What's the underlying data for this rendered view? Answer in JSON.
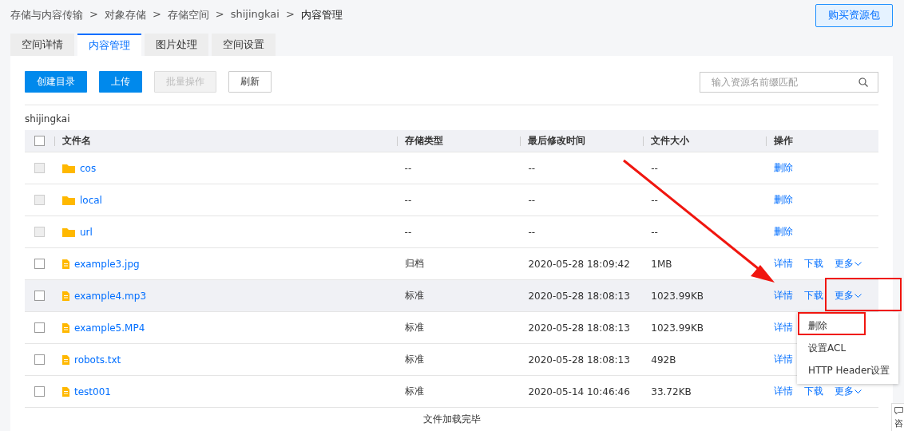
{
  "breadcrumb": [
    "存储与内容传输",
    "对象存储",
    "存储空间",
    "shijingkai",
    "内容管理"
  ],
  "breadcrumb_separator": ">",
  "buy_button": "购买资源包",
  "tabs": [
    {
      "label": "空间详情",
      "selected": false
    },
    {
      "label": "内容管理",
      "selected": true
    },
    {
      "label": "图片处理",
      "selected": false
    },
    {
      "label": "空间设置",
      "selected": false
    }
  ],
  "toolbar": [
    {
      "label": "创建目录",
      "kind": "primary",
      "disabled": false
    },
    {
      "label": "上传",
      "kind": "primary",
      "disabled": false
    },
    {
      "label": "批量操作",
      "kind": "default",
      "disabled": true
    },
    {
      "label": "刷新",
      "kind": "default",
      "disabled": false
    }
  ],
  "search": {
    "placeholder": "输入资源名前缀匹配"
  },
  "path": "shijingkai",
  "table": {
    "select_all_checked": false,
    "columns": [
      "文件名",
      "存储类型",
      "最后修改时间",
      "文件大小",
      "操作"
    ],
    "rows": [
      {
        "kind": "folder",
        "name": "cos",
        "storage": "--",
        "modified": "--",
        "size": "--",
        "actions": [
          "删除"
        ],
        "checked": false,
        "disabled": true,
        "highlighted": false
      },
      {
        "kind": "folder",
        "name": "local",
        "storage": "--",
        "modified": "--",
        "size": "--",
        "actions": [
          "删除"
        ],
        "checked": false,
        "disabled": true,
        "highlighted": false
      },
      {
        "kind": "folder",
        "name": "url",
        "storage": "--",
        "modified": "--",
        "size": "--",
        "actions": [
          "删除"
        ],
        "checked": false,
        "disabled": true,
        "highlighted": false
      },
      {
        "kind": "file",
        "name": "example3.jpg",
        "storage": "归档",
        "modified": "2020-05-28 18:09:42",
        "size": "1MB",
        "actions": [
          "详情",
          "下载",
          "更多"
        ],
        "checked": false,
        "disabled": false,
        "highlighted": false
      },
      {
        "kind": "file",
        "name": "example4.mp3",
        "storage": "标准",
        "modified": "2020-05-28 18:08:13",
        "size": "1023.99KB",
        "actions": [
          "详情",
          "下载",
          "更多"
        ],
        "checked": false,
        "disabled": false,
        "highlighted": true
      },
      {
        "kind": "file",
        "name": "example5.MP4",
        "storage": "标准",
        "modified": "2020-05-28 18:08:13",
        "size": "1023.99KB",
        "actions": [
          "详情"
        ],
        "checked": false,
        "disabled": false,
        "highlighted": false
      },
      {
        "kind": "file",
        "name": "robots.txt",
        "storage": "标准",
        "modified": "2020-05-28 18:08:13",
        "size": "492B",
        "actions": [
          "详情"
        ],
        "checked": false,
        "disabled": false,
        "highlighted": false
      },
      {
        "kind": "file",
        "name": "test001",
        "storage": "标准",
        "modified": "2020-05-14 10:46:46",
        "size": "33.72KB",
        "actions": [
          "详情",
          "下载",
          "更多"
        ],
        "checked": false,
        "disabled": false,
        "highlighted": false
      }
    ],
    "footer": "文件加载完毕"
  },
  "dropdown_menu": [
    "删除",
    "设置ACL",
    "HTTP Header设置"
  ],
  "side_widget": "咨"
}
